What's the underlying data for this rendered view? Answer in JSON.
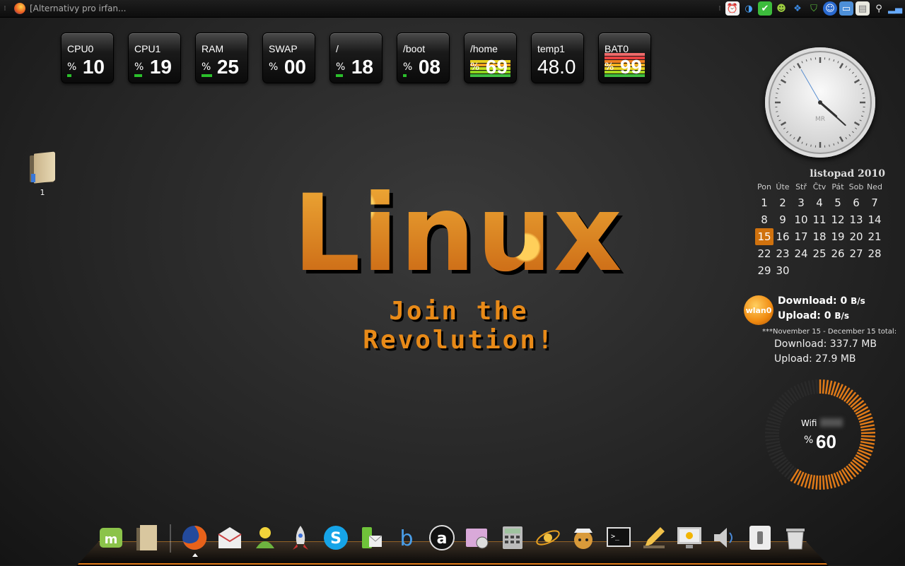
{
  "top_panel": {
    "active_window_title": "[Alternativy pro irfan...",
    "tray_icons": [
      "alarm-clock-icon",
      "network-icon",
      "update-check-icon",
      "user-icon",
      "dropbox-icon",
      "shield-icon",
      "accessibility-icon",
      "screenshot-icon",
      "clipboard-icon",
      "search-icon",
      "signal-bars-icon"
    ]
  },
  "gauges": [
    {
      "label": "CPU0",
      "value": "10",
      "pct": "%",
      "fill": 0.1
    },
    {
      "label": "CPU1",
      "value": "19",
      "pct": "%",
      "fill": 0.19
    },
    {
      "label": "RAM",
      "value": "25",
      "pct": "%",
      "fill": 0.25
    },
    {
      "label": "SWAP",
      "value": "00",
      "pct": "%",
      "fill": 0.0
    },
    {
      "label": "/",
      "value": "18",
      "pct": "%",
      "fill": 0.18
    },
    {
      "label": "/boot",
      "value": "08",
      "pct": "%",
      "fill": 0.08
    },
    {
      "label": "/home",
      "value": "69",
      "pct": "%",
      "fill": 0.69
    },
    {
      "label": "temp1",
      "value": "48.0",
      "pct": "",
      "fill": 0
    },
    {
      "label": "BAT0",
      "value": "99",
      "pct": "%",
      "fill": 0.99
    }
  ],
  "desktop_icon": {
    "label": "1"
  },
  "wallpaper": {
    "title": "Linux",
    "subtitle": "Join the Revolution!"
  },
  "clock": {
    "face_text": "MR",
    "hour": 4,
    "minute": 22,
    "second": 55
  },
  "calendar": {
    "title": "listopad 2010",
    "weekdays": [
      "Pon",
      "Úte",
      "Stř",
      "Čtv",
      "Pát",
      "Sob",
      "Ned"
    ],
    "days": [
      "1",
      "2",
      "3",
      "4",
      "5",
      "6",
      "7",
      "8",
      "9",
      "10",
      "11",
      "12",
      "13",
      "14",
      "15",
      "16",
      "17",
      "18",
      "19",
      "20",
      "21",
      "22",
      "23",
      "24",
      "25",
      "26",
      "27",
      "28",
      "29",
      "30"
    ],
    "today": "15"
  },
  "network": {
    "interface": "wlan0",
    "download_label": "Download:",
    "download_value": "0",
    "upload_label": "Upload:",
    "upload_value": "0",
    "rate_unit": "B/s",
    "period_label": "***November 15 - December 15 total:",
    "total_download": "Download: 337.7 MB",
    "total_upload": "Upload: 27.9 MB"
  },
  "wifi": {
    "label": "Wifi",
    "pct": "%",
    "value": "60",
    "level": 0.6
  },
  "dock": {
    "items": [
      "linux-mint-menu-icon",
      "folder-icon",
      "firefox-icon",
      "mail-icon",
      "pidgin-icon",
      "rocket-icon",
      "skype-icon",
      "phone-sms-icon",
      "b-blogger-icon",
      "a-amarok-icon",
      "screenshot-viewer-icon",
      "calculator-icon",
      "satellite-orbit-icon",
      "cat-agent-icon",
      "terminal-icon",
      "pencil-editor-icon",
      "monitor-settings-icon",
      "volume-speaker-icon",
      "switch-toggle-icon",
      "trash-icon"
    ]
  },
  "colors": {
    "accent": "#e07a18",
    "gauge_green": "#2bbf2b",
    "today": "#d0720e"
  }
}
